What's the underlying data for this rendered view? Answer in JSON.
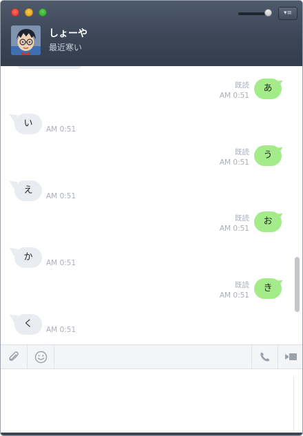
{
  "window": {
    "controls": [
      "close",
      "minimize",
      "maximize"
    ]
  },
  "header": {
    "contact_name": "しょーや",
    "status_message": "最近寒い",
    "menu_icon": "▾≡",
    "volume_slider_value": 0.85
  },
  "messages": [
    {
      "direction": "out",
      "text": "あ",
      "read": "既読",
      "time": "AM 0:51"
    },
    {
      "direction": "in",
      "text": "い",
      "time": "AM 0:51"
    },
    {
      "direction": "out",
      "text": "う",
      "read": "既読",
      "time": "AM 0:51"
    },
    {
      "direction": "in",
      "text": "え",
      "time": "AM 0:51"
    },
    {
      "direction": "out",
      "text": "お",
      "read": "既読",
      "time": "AM 0:51"
    },
    {
      "direction": "in",
      "text": "か",
      "time": "AM 0:51"
    },
    {
      "direction": "out",
      "text": "き",
      "read": "既読",
      "time": "AM 0:51"
    },
    {
      "direction": "in",
      "text": "く",
      "time": "AM 0:51"
    }
  ],
  "toolbar": {
    "icons": [
      "paperclip-icon",
      "emoji-icon",
      "phone-icon",
      "video-icon"
    ]
  },
  "input": {
    "value": "",
    "placeholder": ""
  }
}
